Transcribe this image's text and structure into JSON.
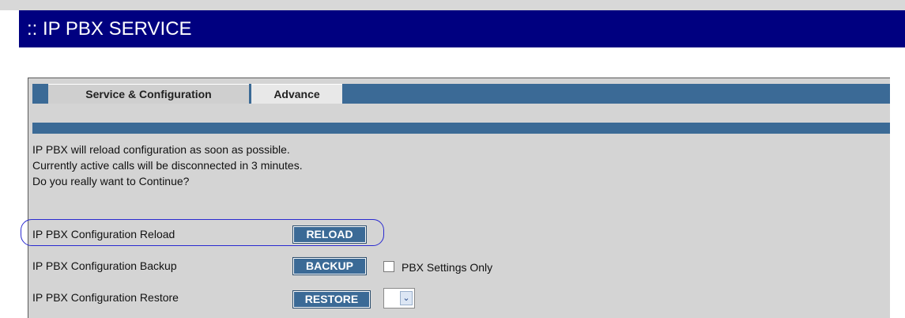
{
  "header": {
    "title": ":: IP PBX SERVICE"
  },
  "tabs": [
    {
      "label": "Service & Configuration",
      "active": true
    },
    {
      "label": "Advance",
      "active": false
    }
  ],
  "message": {
    "lines": [
      "IP PBX will reload configuration as soon as possible.",
      "Currently active calls will be disconnected in 3 minutes.",
      "Do you really want to Continue?"
    ]
  },
  "rows": {
    "reload": {
      "label": "IP PBX Configuration Reload",
      "button": "RELOAD"
    },
    "backup": {
      "label": "IP PBX Configuration Backup",
      "button": "BACKUP",
      "checkbox_label": "PBX Settings Only",
      "checkbox_checked": false
    },
    "restore": {
      "label": "IP PBX Configuration Restore",
      "button": "RESTORE",
      "select_value": ""
    }
  },
  "colors": {
    "header_bg": "#000080",
    "tab_strip": "#3b6a96",
    "panel_bg": "#d4d4d4",
    "highlight": "#2a2ad0"
  },
  "icons": {
    "select_arrow": "chevron-down-icon"
  }
}
